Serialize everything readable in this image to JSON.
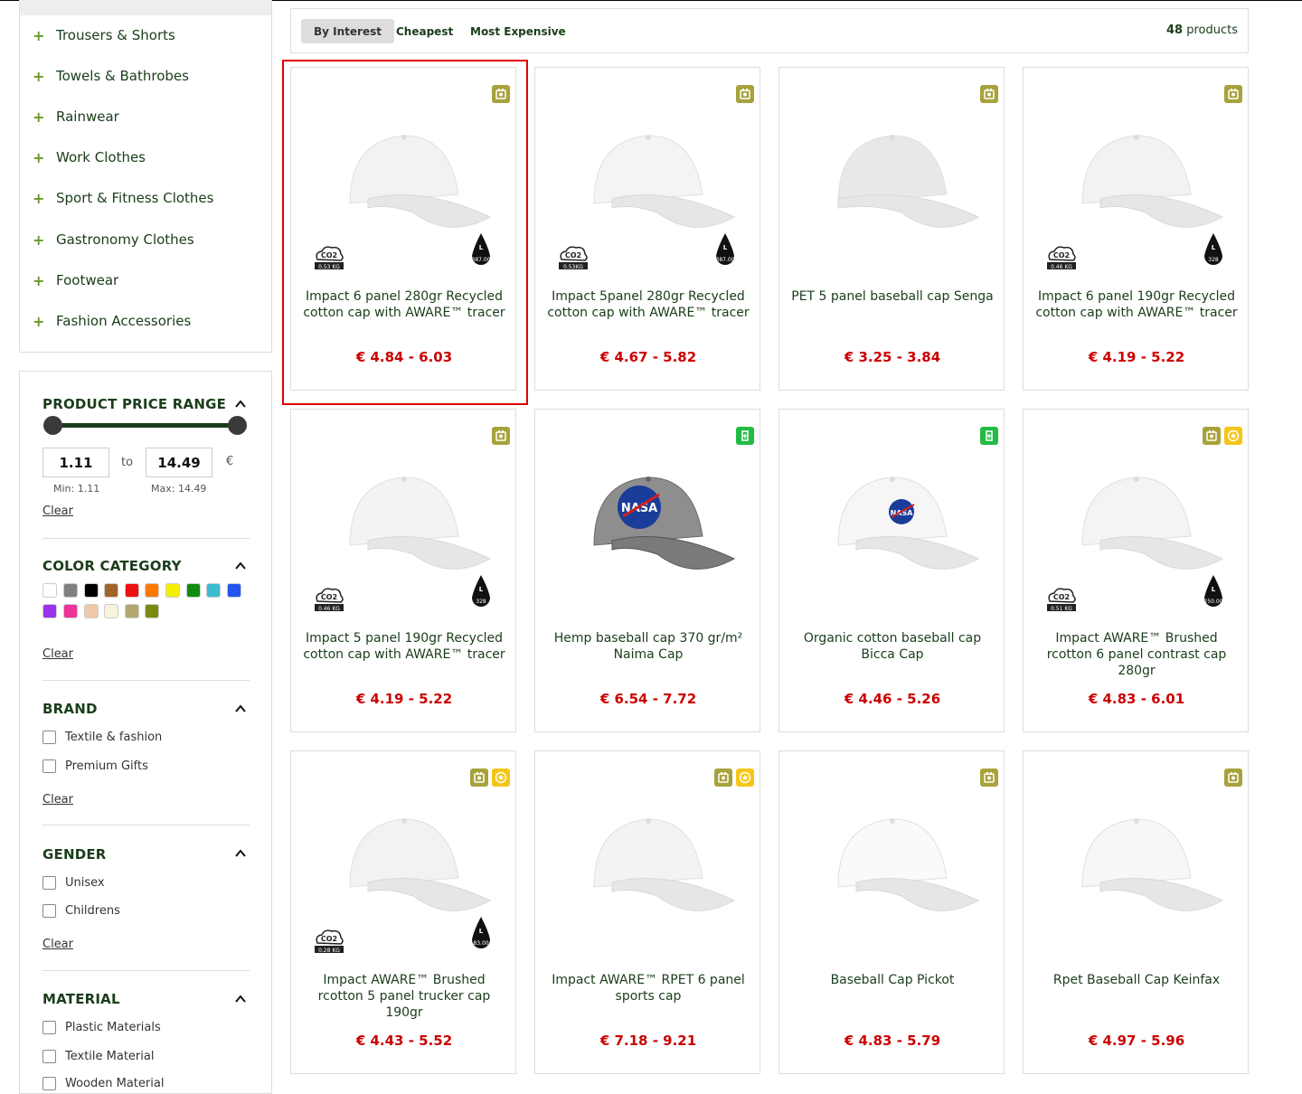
{
  "categories": [
    {
      "label": "Trousers & Shorts"
    },
    {
      "label": "Towels & Bathrobes"
    },
    {
      "label": "Rainwear"
    },
    {
      "label": "Work Clothes"
    },
    {
      "label": "Sport & Fitness Clothes"
    },
    {
      "label": "Gastronomy Clothes"
    },
    {
      "label": "Footwear"
    },
    {
      "label": "Fashion Accessories"
    }
  ],
  "filters": {
    "price": {
      "title": "PRODUCT PRICE RANGE",
      "min_value": "1.11",
      "max_value": "14.49",
      "to_label": "to",
      "currency": "€",
      "min_hint": "Min: 1.11",
      "max_hint": "Max: 14.49",
      "clear": "Clear"
    },
    "color": {
      "title": "COLOR CATEGORY",
      "swatches": [
        "#ffffff",
        "#808080",
        "#000000",
        "#a0642a",
        "#ee1111",
        "#ff7a00",
        "#f5f000",
        "#108a10",
        "#3cbcd0",
        "#2255ee",
        "#9933ee",
        "#ee3399",
        "#f0c8a8",
        "#f5f5dc",
        "#b0a870",
        "#7a8a10"
      ],
      "clear": "Clear"
    },
    "brand": {
      "title": "BRAND",
      "options": [
        "Textile & fashion",
        "Premium Gifts"
      ],
      "clear": "Clear"
    },
    "gender": {
      "title": "GENDER",
      "options": [
        "Unisex",
        "Childrens"
      ],
      "clear": "Clear"
    },
    "material": {
      "title": "MATERIAL",
      "options": [
        "Plastic Materials",
        "Textile Material",
        "Wooden Material"
      ]
    }
  },
  "sort": {
    "options": [
      "By Interest",
      "Cheapest",
      "Most Expensive"
    ],
    "active": "By Interest",
    "count_number": "48",
    "count_label": "products"
  },
  "products": [
    {
      "name": "Impact 6 panel 280gr Recycled cotton cap with AWARE™ tracer",
      "price": "€ 4.84 - 6.03",
      "cap_color": "#f2f2f2",
      "badges": [
        "olive"
      ],
      "co2": "0.53 KG",
      "water": "387.00"
    },
    {
      "name": "Impact 5panel 280gr Recycled cotton cap with AWARE™ tracer",
      "price": "€ 4.67 - 5.82",
      "cap_color": "#f4f4f4",
      "badges": [
        "olive"
      ],
      "co2": "0.53KG",
      "water": "387.00"
    },
    {
      "name": "PET 5 panel baseball cap Senga",
      "price": "€ 3.25 - 3.84",
      "cap_color": "#e8e8ea",
      "badges": [
        "olive"
      ]
    },
    {
      "name": "Impact 6 panel 190gr Recycled cotton cap with AWARE™ tracer",
      "price": "€ 4.19 - 5.22",
      "cap_color": "#f2f2f2",
      "badges": [
        "olive"
      ],
      "co2": "0.46 KG",
      "water": "328"
    },
    {
      "name": "Impact 5 panel 190gr Recycled cotton cap with AWARE™ tracer",
      "price": "€ 4.19 - 5.22",
      "cap_color": "#f3f3f3",
      "badges": [
        "olive"
      ],
      "co2": "0.46 KG",
      "water": "328"
    },
    {
      "name": "Hemp baseball cap 370 gr/m² Naima Cap",
      "price": "€ 6.54 - 7.72",
      "cap_color": "#8e8e8e",
      "badges": [
        "green"
      ],
      "nasa": true
    },
    {
      "name": "Organic cotton baseball cap Bicca Cap",
      "price": "€ 4.46 - 5.26",
      "cap_color": "#f6f6f6",
      "badges": [
        "green"
      ],
      "nasa": true
    },
    {
      "name": "Impact AWARE™ Brushed rcotton 6 panel contrast cap 280gr",
      "price": "€ 4.83 - 6.01",
      "cap_color": "#f4f4f4",
      "badges": [
        "olive",
        "yellow"
      ],
      "co2": "0.51 KG",
      "water": "250.00"
    },
    {
      "name": "Impact AWARE™ Brushed rcotton 5 panel trucker cap 190gr",
      "price": "€ 4.43 - 5.52",
      "cap_color": "#f2f2f2",
      "badges": [
        "olive",
        "yellow"
      ],
      "co2": "0.28 KG",
      "water": "83.00"
    },
    {
      "name": "Impact AWARE™ RPET 6 panel sports cap",
      "price": "€ 7.18 - 9.21",
      "cap_color": "#f3f3f3",
      "badges": [
        "olive",
        "yellow"
      ]
    },
    {
      "name": "Baseball Cap Pickot",
      "price": "€ 4.83 - 5.79",
      "cap_color": "#fafafa",
      "badges": [
        "olive"
      ]
    },
    {
      "name": "Rpet Baseball Cap Keinfax",
      "price": "€ 4.97 - 5.96",
      "cap_color": "#f7f7fa",
      "badges": [
        "olive"
      ]
    }
  ],
  "co2_label": "CO2",
  "nasa_label": "NASA",
  "water_label": "L"
}
